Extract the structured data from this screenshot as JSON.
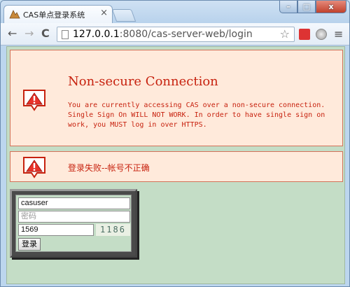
{
  "browser": {
    "tab_title": "CAS单点登录系统",
    "tab_close": "×",
    "url_host": "127.0.0.1",
    "url_rest": ":8080/cas-server-web/login",
    "back": "←",
    "forward": "→",
    "reload": "C",
    "star": "☆",
    "menu": "≡",
    "window_min": "–",
    "window_max": "□",
    "window_close": "x"
  },
  "warning": {
    "title": "Non-secure Connection",
    "body": "You are currently accessing CAS over a non-secure connection. Single Sign On WILL NOT WORK. In order to have single sign on work, you MUST log in over HTTPS."
  },
  "error": {
    "text": "登录失败--帐号不正确"
  },
  "login_form": {
    "username_value": "casuser",
    "password_placeholder": "密码",
    "code_value": "1569",
    "captcha_text": "1186",
    "submit_label": "登录"
  },
  "colors": {
    "message_text": "#c7220f",
    "message_bg": "#ffeadb",
    "page_bg": "#c4ddc6"
  },
  "icons": {
    "alert": "alert-icon",
    "favicon": "cas-favicon-icon"
  }
}
